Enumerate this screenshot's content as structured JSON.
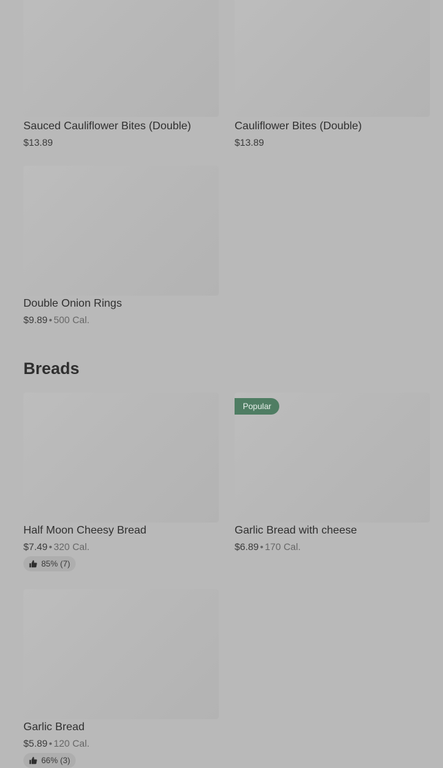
{
  "sections": {
    "breads_title": "Breads"
  },
  "items": {
    "sauced_cauliflower": {
      "name": "Sauced Cauliflower Bites (Double)",
      "price": "$13.89"
    },
    "cauliflower": {
      "name": "Cauliflower Bites (Double)",
      "price": "$13.89"
    },
    "onion_rings": {
      "name": "Double Onion Rings",
      "price": "$9.89",
      "calories": "500 Cal."
    },
    "half_moon": {
      "name": "Half Moon Cheesy Bread",
      "price": "$7.49",
      "calories": "320 Cal.",
      "rating": "85% (7)"
    },
    "garlic_cheese": {
      "name": "Garlic Bread with cheese",
      "price": "$6.89",
      "calories": "170 Cal.",
      "badge": "Popular"
    },
    "garlic_bread": {
      "name": "Garlic Bread",
      "price": "$5.89",
      "calories": "120 Cal.",
      "rating": "66% (3)"
    }
  },
  "colors": {
    "background": "#b9b9b9",
    "badge": "#4f7d63",
    "text": "#2f2f2f"
  }
}
